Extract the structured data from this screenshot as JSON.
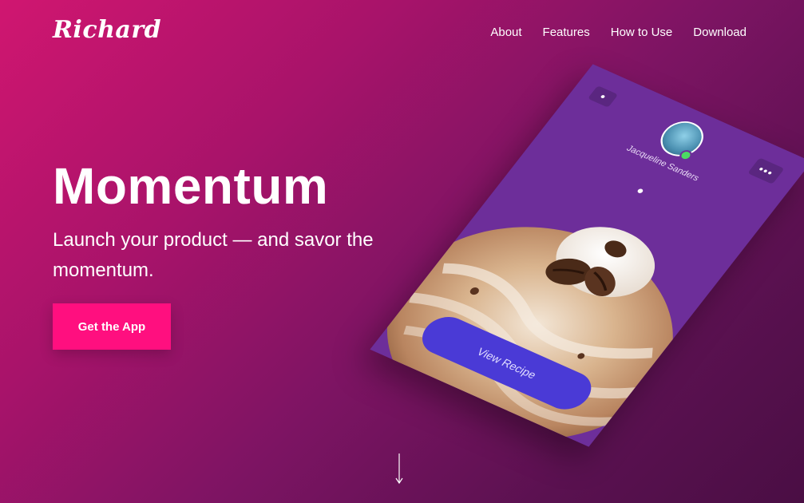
{
  "brand": {
    "logo": "Richard"
  },
  "nav": {
    "items": [
      "About",
      "Features",
      "How to Use",
      "Download"
    ]
  },
  "hero": {
    "title": "Momentum",
    "subtitle": "Launch your product — and savor the momentum.",
    "cta_label": "Get the App"
  },
  "phone": {
    "profile_name": "Jacqueline Sanders",
    "profile_sub": "",
    "more_label": "•••",
    "view_recipe_label": "View Recipe"
  },
  "colors": {
    "accent": "#ff0f7f",
    "phone_bg": "#6d2e9a",
    "recipe_button": "#4a3ad6"
  }
}
